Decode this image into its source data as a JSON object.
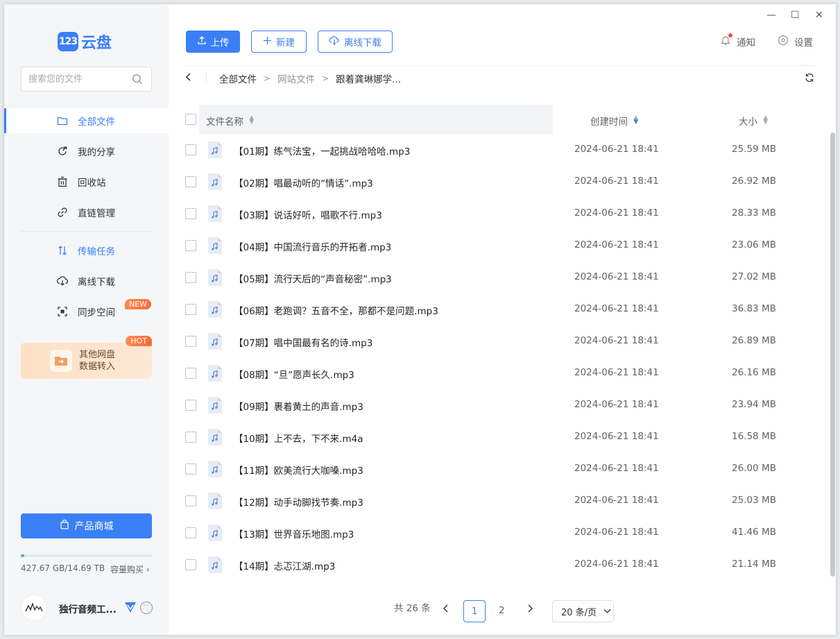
{
  "app": {
    "logo_badge": "123",
    "logo_text": "云盘"
  },
  "search": {
    "placeholder": "搜索您的文件"
  },
  "nav": [
    {
      "label": "全部文件",
      "icon": "folder-icon"
    },
    {
      "label": "我的分享",
      "icon": "share-icon"
    },
    {
      "label": "回收站",
      "icon": "trash-icon"
    },
    {
      "label": "直链管理",
      "icon": "link-icon"
    },
    {
      "label": "传输任务",
      "icon": "transfer-icon"
    },
    {
      "label": "离线下载",
      "icon": "cloud-download-icon"
    },
    {
      "label": "同步空间",
      "icon": "sync-space-icon",
      "badge": "NEW"
    }
  ],
  "promo": {
    "line1": "其他网盘",
    "line2": "数据转入",
    "badge": "HOT"
  },
  "shop_button": "产品商城",
  "storage": {
    "text": "427.67 GB/14.69 TB",
    "fraction": 0.028,
    "buy": "容量购买"
  },
  "user": {
    "name": "独行音频工..."
  },
  "toolbar": {
    "upload": "上传",
    "new": "新建",
    "offline": "离线下载",
    "notify": "通知",
    "settings": "设置"
  },
  "breadcrumb": [
    "全部文件",
    "网站文件",
    "跟着龚琳娜学..."
  ],
  "table": {
    "headers": {
      "name": "文件名称",
      "date": "创建时间",
      "size": "大小"
    },
    "rows": [
      {
        "name": "【01期】练气法宝，一起挑战哈哈哈.mp3",
        "date": "2024-06-21 18:41",
        "size": "25.59 MB"
      },
      {
        "name": "【02期】唱最动听的“情话”.mp3",
        "date": "2024-06-21 18:41",
        "size": "26.92 MB"
      },
      {
        "name": "【03期】说话好听，唱歌不行.mp3",
        "date": "2024-06-21 18:41",
        "size": "28.33 MB"
      },
      {
        "name": "【04期】中国流行音乐的开拓者.mp3",
        "date": "2024-06-21 18:41",
        "size": "23.06 MB"
      },
      {
        "name": "【05期】流行天后的“声音秘密”.mp3",
        "date": "2024-06-21 18:41",
        "size": "27.02 MB"
      },
      {
        "name": "【06期】老跑调？五音不全，那都不是问题.mp3",
        "date": "2024-06-21 18:41",
        "size": "36.83 MB"
      },
      {
        "name": "【07期】唱中国最有名的诗.mp3",
        "date": "2024-06-21 18:41",
        "size": "26.89 MB"
      },
      {
        "name": "【08期】“旦”愿声长久.mp3",
        "date": "2024-06-21 18:41",
        "size": "26.16 MB"
      },
      {
        "name": "【09期】裹着黄土的声音.mp3",
        "date": "2024-06-21 18:41",
        "size": "23.94 MB"
      },
      {
        "name": "【10期】上不去，下不来.m4a",
        "date": "2024-06-21 18:41",
        "size": "16.58 MB"
      },
      {
        "name": "【11期】欧美流行大咖嗓.mp3",
        "date": "2024-06-21 18:41",
        "size": "26.00 MB"
      },
      {
        "name": "【12期】动手动脚找节奏.mp3",
        "date": "2024-06-21 18:41",
        "size": "25.03 MB"
      },
      {
        "name": "【13期】世界音乐地图.mp3",
        "date": "2024-06-21 18:41",
        "size": "41.46 MB"
      },
      {
        "name": "【14期】忐忑江湖.mp3",
        "date": "2024-06-21 18:41",
        "size": "21.14 MB"
      }
    ]
  },
  "pagination": {
    "total": "共 26 条",
    "page1": "1",
    "page2": "2",
    "page_size": "20 条/页"
  },
  "colors": {
    "accent": "#3b7ff6",
    "storage": "#4fc85f"
  }
}
